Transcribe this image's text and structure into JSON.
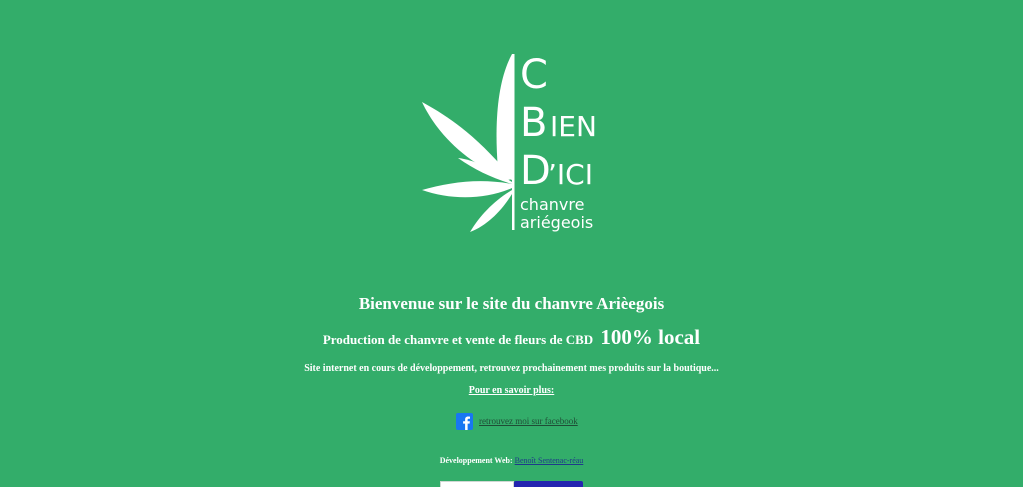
{
  "logo": {
    "line1": "C",
    "line2_initial": "B",
    "line2_rest": "IEN",
    "line3_initial": "D",
    "line3_rest": "’ICI",
    "tag1": "chanvre",
    "tag2": "ariégeois",
    "icon": "hemp-leaf-icon"
  },
  "headline": "Bienvenue sur le site du chanvre Arièegois",
  "subline": {
    "text": "Production de chanvre et vente de fleurs de CBD",
    "emphasis": "100% local"
  },
  "notice": "Site internet en cours de développement, retrouvez prochainement mes produits sur la boutique...",
  "more_link": "Pour en savoir plus:",
  "facebook": {
    "icon": "facebook-icon",
    "link_text": "retrouvez moi sur facebook"
  },
  "credit": {
    "label": "Développement Web:",
    "link_text": "Benoît Sentenac-réau"
  },
  "colors": {
    "background": "#33ad6a",
    "text": "#ffffff",
    "facebook_blue": "#1877f2",
    "button_blue": "#2424b0"
  }
}
